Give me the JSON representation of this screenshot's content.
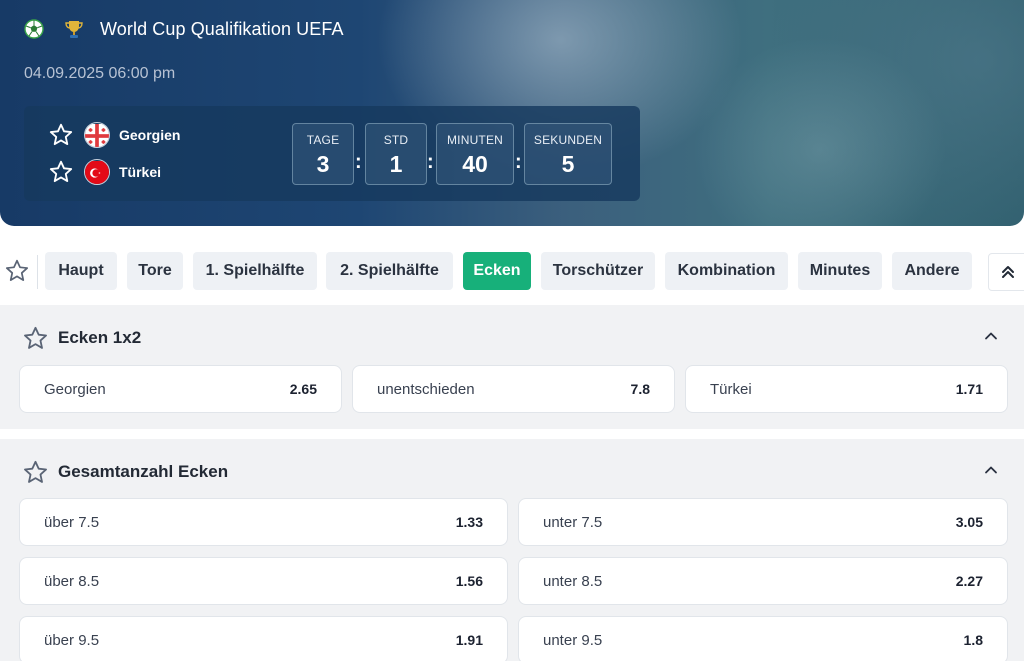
{
  "header": {
    "league": "World Cup Qualifikation UEFA",
    "date": "04.09.2025 06:00 pm",
    "home_team": "Georgien",
    "away_team": "Türkei",
    "countdown": [
      {
        "label": "TAGE",
        "value": "3"
      },
      {
        "label": "STD",
        "value": "1"
      },
      {
        "label": "MINUTEN",
        "value": "40"
      },
      {
        "label": "SEKUNDEN",
        "value": "5"
      }
    ],
    "separator": ":"
  },
  "tabs": [
    {
      "label": "Haupt"
    },
    {
      "label": "Tore"
    },
    {
      "label": "1. Spielhälfte"
    },
    {
      "label": "2. Spielhälfte"
    },
    {
      "label": "Ecken",
      "active": true
    },
    {
      "label": "Torschützer"
    },
    {
      "label": "Kombination"
    },
    {
      "label": "Minutes"
    },
    {
      "label": "Andere"
    }
  ],
  "markets": {
    "corners_1x2": {
      "title": "Ecken 1x2",
      "outcomes": [
        {
          "label": "Georgien",
          "odds": "2.65"
        },
        {
          "label": "unentschieden",
          "odds": "7.8"
        },
        {
          "label": "Türkei",
          "odds": "1.71"
        }
      ]
    },
    "total_corners": {
      "title": "Gesamtanzahl Ecken",
      "rows": [
        {
          "over_label": "über 7.5",
          "over_odds": "1.33",
          "under_label": "unter 7.5",
          "under_odds": "3.05"
        },
        {
          "over_label": "über 8.5",
          "over_odds": "1.56",
          "under_label": "unter 8.5",
          "under_odds": "2.27"
        },
        {
          "over_label": "über 9.5",
          "over_odds": "1.91",
          "under_label": "unter 9.5",
          "under_odds": "1.8"
        }
      ]
    }
  },
  "colors": {
    "accent_green": "#17b07a",
    "header_navy": "#173a66",
    "section_bg": "#f1f2f4"
  },
  "icons": {
    "sport": "soccer-ball-icon",
    "league": "trophy-icon",
    "favorite": "star-outline-icon",
    "collapse_all": "double-chevron-up-icon",
    "collapse_section": "chevron-up-icon"
  }
}
